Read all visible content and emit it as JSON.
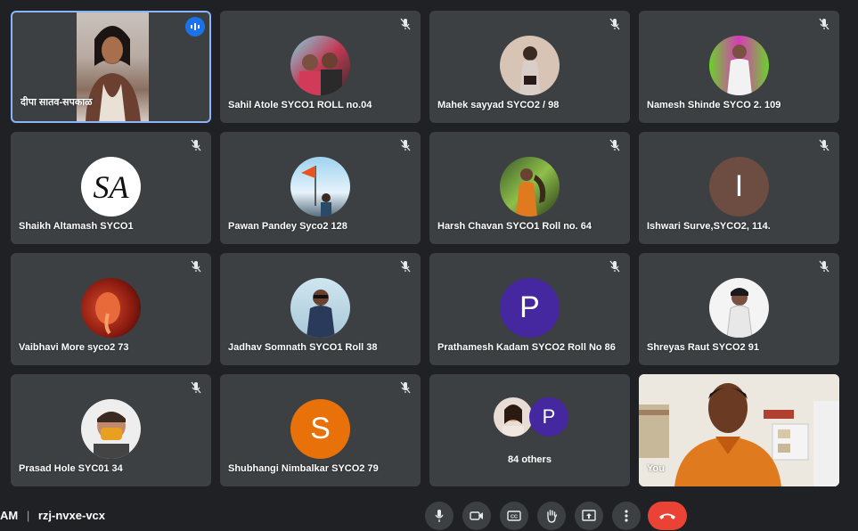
{
  "tiles": [
    {
      "name": "दीपा सातव-सपकाळ",
      "mic_muted": false,
      "speaking": true,
      "media": "camera"
    },
    {
      "name": "Sahil Atole SYCO1 ROLL no.04",
      "mic_muted": true,
      "media": "photo"
    },
    {
      "name": "Mahek sayyad SYCO2 / 98",
      "mic_muted": true,
      "media": "photo"
    },
    {
      "name": "Namesh Shinde SYCO 2. 109",
      "mic_muted": true,
      "media": "photo"
    },
    {
      "name": "Shaikh Altamash SYCO1",
      "mic_muted": true,
      "media": "logo",
      "logo_text": "SA"
    },
    {
      "name": "Pawan Pandey Syco2 128",
      "mic_muted": true,
      "media": "photo"
    },
    {
      "name": "Harsh Chavan SYCO1 Roll no. 64",
      "mic_muted": true,
      "media": "photo"
    },
    {
      "name": "Ishwari Surve,SYCO2, 114.",
      "mic_muted": true,
      "media": "letter",
      "initial": "I",
      "color": "#6d4c41"
    },
    {
      "name": "Vaibhavi More syco2 73",
      "mic_muted": true,
      "media": "photo"
    },
    {
      "name": "Jadhav Somnath SYCO1 Roll 38",
      "mic_muted": true,
      "media": "photo"
    },
    {
      "name": "Prathamesh Kadam SYCO2 Roll No 86",
      "mic_muted": true,
      "media": "letter",
      "initial": "P",
      "color": "#4527a0"
    },
    {
      "name": "Shreyas Raut SYCO2 91",
      "mic_muted": true,
      "media": "photo"
    },
    {
      "name": "Prasad Hole SYC01 34",
      "mic_muted": true,
      "media": "photo"
    },
    {
      "name": "Shubhangi Nimbalkar SYCO2 79",
      "mic_muted": true,
      "media": "letter",
      "initial": "S",
      "color": "#e8710a"
    }
  ],
  "others_tile": {
    "label": "84 others",
    "initial": "P",
    "initial_color": "#4527a0"
  },
  "self_tile": {
    "label": "You"
  },
  "bottom_bar": {
    "time_fragment": "AM",
    "separator": "|",
    "meeting_code": "rzj-nvxe-vcx",
    "controls": [
      "mic-icon",
      "camera-icon",
      "captions-icon",
      "raise-hand-icon",
      "present-icon",
      "more-options-icon",
      "end-call-icon"
    ],
    "end_call_color": "#ea4335",
    "accent_color": "#1a73e8"
  }
}
